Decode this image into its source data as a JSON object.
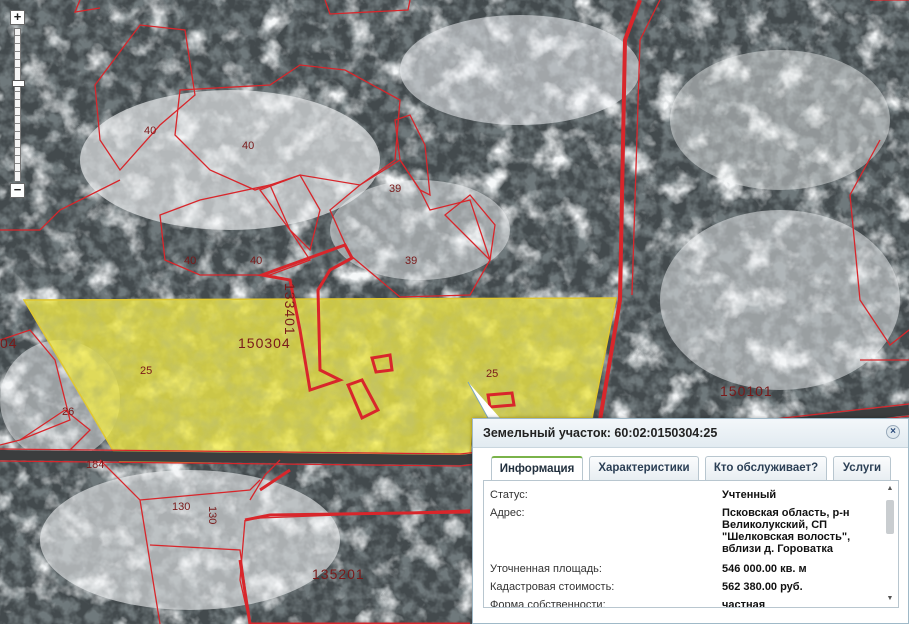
{
  "map": {
    "parcel_labels": [
      {
        "text": "40",
        "cls": ""
      },
      {
        "text": "40",
        "cls": ""
      },
      {
        "text": "40",
        "cls": ""
      },
      {
        "text": "40",
        "cls": ""
      },
      {
        "text": "39",
        "cls": ""
      },
      {
        "text": "39",
        "cls": ""
      },
      {
        "text": "25",
        "cls": ""
      },
      {
        "text": "25",
        "cls": ""
      },
      {
        "text": "26",
        "cls": ""
      },
      {
        "text": "184",
        "cls": ""
      },
      {
        "text": "130",
        "cls": ""
      },
      {
        "text": "130",
        "cls": ""
      },
      {
        "text": "150304",
        "cls": "big"
      },
      {
        "text": "150101",
        "cls": "big"
      },
      {
        "text": "135201",
        "cls": "big"
      },
      {
        "text": "133401",
        "cls": "big"
      },
      {
        "text": "04",
        "cls": "big"
      }
    ],
    "colors": {
      "boundary": "#d8262b",
      "highlight": "#f2ea47",
      "snow": "#eef1f3",
      "forest": "#2c3233"
    }
  },
  "zoom": {
    "plus_label": "+",
    "minus_label": "−"
  },
  "popup": {
    "title": "Земельный участок: 60:02:0150304:25",
    "close_label": "×",
    "tabs": [
      {
        "label": "Информация",
        "active": true
      },
      {
        "label": "Характеристики",
        "active": false
      },
      {
        "label": "Кто обслуживает?",
        "active": false
      },
      {
        "label": "Услуги",
        "active": false
      }
    ],
    "fields": [
      {
        "key": "Статус:",
        "value": "Учтенный"
      },
      {
        "key": "Адрес:",
        "value": "Псковская область, р-н Великолукский, СП \"Шелковская волость\", вблизи д. Горовaтка"
      },
      {
        "key": "Уточненная площадь:",
        "value": "546 000.00 кв. м"
      },
      {
        "key": "Кадастровая стоимость:",
        "value": "562 380.00 руб."
      },
      {
        "key": "Форма собственности:",
        "value": "частная"
      }
    ],
    "scroll_up": "▲",
    "scroll_down": "▼"
  }
}
